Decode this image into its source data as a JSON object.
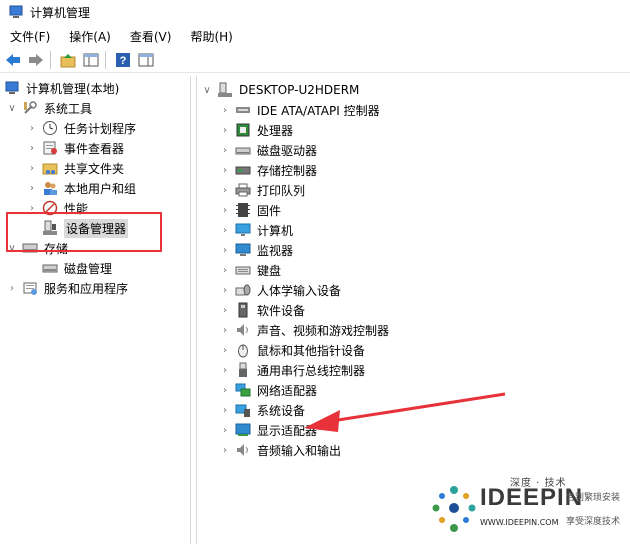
{
  "window": {
    "title": "计算机管理"
  },
  "menu": [
    {
      "label": "文件(F)"
    },
    {
      "label": "操作(A)"
    },
    {
      "label": "查看(V)"
    },
    {
      "label": "帮助(H)"
    }
  ],
  "toolbar": {
    "back_icon": "back-arrow-icon",
    "forward_icon": "forward-arrow-icon",
    "up_icon": "folder-up-icon",
    "console_icon": "show-console-tree-icon",
    "help_icon": "help-icon",
    "action_pane_icon": "action-pane-icon"
  },
  "left_tree": {
    "root": "计算机管理(本地)",
    "system_tools": "系统工具",
    "task_scheduler": "任务计划程序",
    "event_viewer": "事件查看器",
    "shared_folders": "共享文件夹",
    "local_users": "本地用户和组",
    "performance": "性能",
    "device_manager": "设备管理器",
    "storage": "存储",
    "disk_management": "磁盘管理",
    "services_apps": "服务和应用程序"
  },
  "right_tree": {
    "computer": "DESKTOP-U2HDERM",
    "categories": [
      {
        "label": "IDE ATA/ATAPI 控制器",
        "icon": "ide-controller-icon"
      },
      {
        "label": "处理器",
        "icon": "processor-icon"
      },
      {
        "label": "磁盘驱动器",
        "icon": "disk-drive-icon"
      },
      {
        "label": "存储控制器",
        "icon": "storage-controller-icon"
      },
      {
        "label": "打印队列",
        "icon": "printer-icon"
      },
      {
        "label": "固件",
        "icon": "firmware-icon"
      },
      {
        "label": "计算机",
        "icon": "computer-icon"
      },
      {
        "label": "监视器",
        "icon": "monitor-icon"
      },
      {
        "label": "键盘",
        "icon": "keyboard-icon"
      },
      {
        "label": "人体学输入设备",
        "icon": "hid-icon"
      },
      {
        "label": "软件设备",
        "icon": "software-device-icon"
      },
      {
        "label": "声音、视频和游戏控制器",
        "icon": "sound-icon"
      },
      {
        "label": "鼠标和其他指针设备",
        "icon": "mouse-icon"
      },
      {
        "label": "通用串行总线控制器",
        "icon": "usb-icon"
      },
      {
        "label": "网络适配器",
        "icon": "network-adapter-icon"
      },
      {
        "label": "系统设备",
        "icon": "system-device-icon"
      },
      {
        "label": "显示适配器",
        "icon": "display-adapter-icon"
      },
      {
        "label": "音频输入和输出",
        "icon": "audio-io-icon"
      }
    ]
  },
  "annotation": {
    "box_color": "#e8323a",
    "arrow_color": "#e8323a"
  },
  "watermark": {
    "title": "深度 · 技术",
    "brand": "IDEEPIN",
    "url": "WWW.IDEEPIN.COM",
    "tag1": "告别繁琐安装",
    "tag2": "享受深度技术"
  }
}
